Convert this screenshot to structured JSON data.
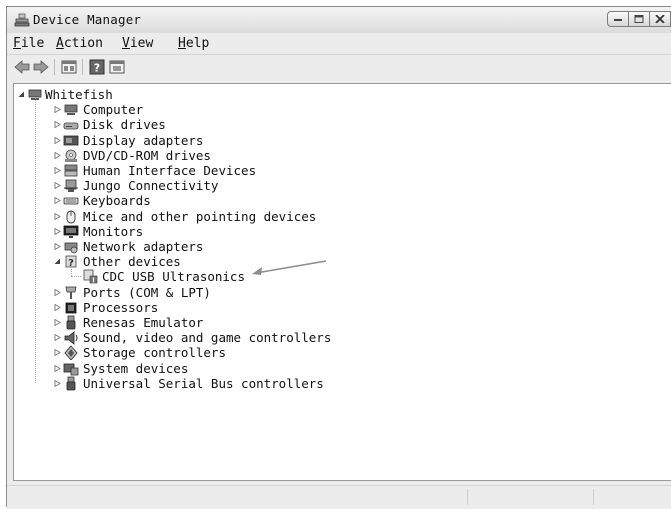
{
  "window": {
    "title": "Device Manager"
  },
  "menu": {
    "items": [
      {
        "acc": "F",
        "rest": "ile"
      },
      {
        "acc": "A",
        "rest": "ction"
      },
      {
        "acc": "V",
        "rest": "iew"
      },
      {
        "acc": "H",
        "rest": "elp"
      }
    ]
  },
  "toolbar": {
    "buttons": [
      "back-icon",
      "forward-icon",
      "properties-icon",
      "help-icon",
      "update-driver-icon"
    ]
  },
  "tree": {
    "root": {
      "label": "Whitefish",
      "icon": "computer-icon",
      "expanded": true
    },
    "categories": [
      {
        "label": "Computer",
        "icon": "computer-icon"
      },
      {
        "label": "Disk drives",
        "icon": "disk-drive-icon"
      },
      {
        "label": "Display adapters",
        "icon": "display-adapter-icon"
      },
      {
        "label": "DVD/CD-ROM drives",
        "icon": "dvd-drive-icon"
      },
      {
        "label": "Human Interface Devices",
        "icon": "hid-icon"
      },
      {
        "label": "Jungo Connectivity",
        "icon": "jungo-icon"
      },
      {
        "label": "Keyboards",
        "icon": "keyboard-icon"
      },
      {
        "label": "Mice and other pointing devices",
        "icon": "mouse-icon"
      },
      {
        "label": "Monitors",
        "icon": "monitor-icon"
      },
      {
        "label": "Network adapters",
        "icon": "network-adapter-icon"
      },
      {
        "label": "Other devices",
        "icon": "other-devices-icon",
        "expanded": true,
        "children": [
          {
            "label": "CDC USB Ultrasonics",
            "icon": "unknown-device-icon"
          }
        ]
      },
      {
        "label": "Ports (COM & LPT)",
        "icon": "port-icon"
      },
      {
        "label": "Processors",
        "icon": "processor-icon"
      },
      {
        "label": "Renesas Emulator",
        "icon": "usb-icon"
      },
      {
        "label": "Sound, video and game controllers",
        "icon": "sound-icon"
      },
      {
        "label": "Storage controllers",
        "icon": "storage-controller-icon"
      },
      {
        "label": "System devices",
        "icon": "system-devices-icon"
      },
      {
        "label": "Universal Serial Bus controllers",
        "icon": "usb-icon"
      }
    ]
  },
  "annotation": {
    "icon": "pointer-arrow-icon"
  }
}
